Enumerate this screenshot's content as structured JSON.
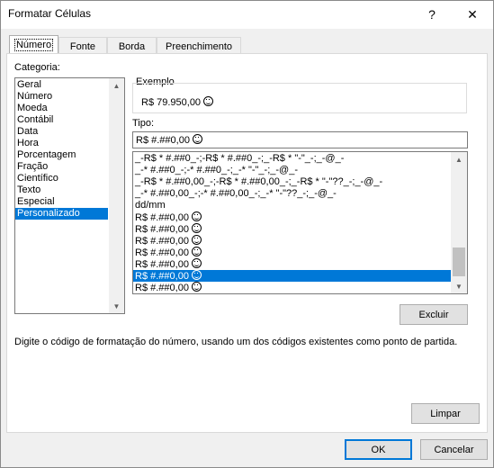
{
  "window": {
    "title": "Formatar Células",
    "help_glyph": "?",
    "close_glyph": "✕"
  },
  "tabs": [
    "Número",
    "Fonte",
    "Borda",
    "Preenchimento"
  ],
  "categoria": {
    "label": "Categoria:",
    "items": [
      "Geral",
      "Número",
      "Moeda",
      "Contábil",
      "Data",
      "Hora",
      "Porcentagem",
      "Fração",
      "Científico",
      "Texto",
      "Especial",
      "Personalizado"
    ],
    "selected_index": 11
  },
  "exemplo": {
    "label": "Exemplo",
    "value": "R$ 79.950,00"
  },
  "tipo": {
    "label": "Tipo:",
    "input_value": "R$ #.##0,00",
    "items": [
      "_-R$ * #.##0_-;-R$ * #.##0_-;_-R$ * \"-\"_-;_-@_-",
      "_-* #.##0_-;-* #.##0_-;_-* \"-\"_-;_-@_-",
      "_-R$ * #.##0,00_-;-R$ * #.##0,00_-;_-R$ * \"-\"??_-;_-@_-",
      "_-* #.##0,00_-;-* #.##0,00_-;_-* \"-\"??_-;_-@_-",
      "dd/mm",
      "R$ #.##0,00",
      "R$ #.##0,00",
      "R$ #.##0,00",
      "R$ #.##0,00",
      "R$ #.##0,00",
      "R$ #.##0,00",
      "R$ #.##0,00"
    ],
    "item_has_icon": [
      false,
      false,
      false,
      false,
      false,
      true,
      true,
      true,
      true,
      true,
      true,
      true
    ],
    "selected_index": 10
  },
  "buttons": {
    "excluir": "Excluir",
    "limpar": "Limpar",
    "ok": "OK",
    "cancelar": "Cancelar"
  },
  "description": "Digite o código de formatação do número, usando um dos códigos existentes como ponto de partida.",
  "icons": [
    "smiley-icon",
    "help-icon",
    "close-icon",
    "scroll-up-icon",
    "scroll-down-icon"
  ],
  "colors": {
    "selection": "#0078d7",
    "dialog_bg": "#f0f0f0",
    "default_button_border": "#0078d7"
  }
}
